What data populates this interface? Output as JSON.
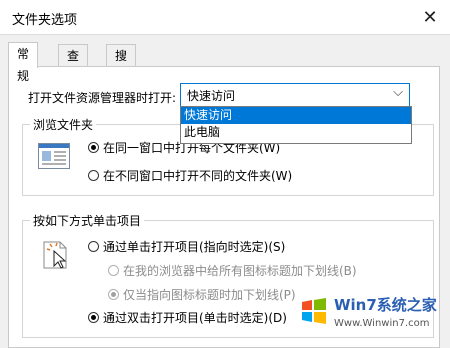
{
  "window": {
    "title": "文件夹选项",
    "close_glyph": "✕"
  },
  "tabs": [
    {
      "label": "常规",
      "active": true
    },
    {
      "label": "查看",
      "active": false
    },
    {
      "label": "搜索",
      "active": false
    }
  ],
  "open_explorer": {
    "label": "打开文件资源管理器时打开:",
    "value": "快速访问",
    "options": [
      "快速访问",
      "此电脑"
    ]
  },
  "browse_folders": {
    "legend": "浏览文件夹",
    "options": [
      {
        "label": "在同一窗口中打开每个文件夹(W)",
        "checked": true
      },
      {
        "label": "在不同窗口中打开不同的文件夹(W)",
        "checked": false
      }
    ]
  },
  "click_items": {
    "legend": "按如下方式单击项目",
    "single_click": {
      "label": "通过单击打开项目(指向时选定)(S)",
      "checked": false
    },
    "underline_all": {
      "label": "在我的浏览器中给所有图标标题加下划线(B)",
      "checked": false
    },
    "underline_point": {
      "label": "仅当指向图标标题时加下划线(P)",
      "checked": true
    },
    "double_click": {
      "label": "通过双击打开项目(单击时选定)(D)",
      "checked": true
    }
  },
  "watermark": {
    "text": "Win7系统之家",
    "url": "Www.Winwin7.com"
  },
  "colors": {
    "accent": "#0078d7",
    "disabled": "#8c8c8c",
    "border": "#d4d4d4"
  }
}
